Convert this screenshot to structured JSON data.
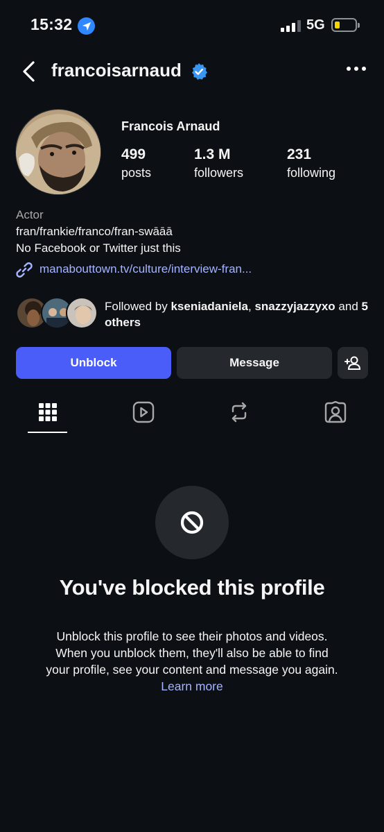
{
  "status_bar": {
    "time": "15:32",
    "network": "5G",
    "battery_level": 0.2,
    "icons": [
      "location-arrow-icon",
      "cellular-signal-icon",
      "battery-icon"
    ]
  },
  "header": {
    "username": "francoisarnaud",
    "verified": true,
    "icons": [
      "back-chevron-icon",
      "verified-badge-icon",
      "more-options-icon"
    ]
  },
  "profile": {
    "display_name": "Francois Arnaud",
    "stats": {
      "posts_value": "499",
      "posts_label": "posts",
      "followers_value": "1.3 M",
      "followers_label": "followers",
      "following_value": "231",
      "following_label": "following"
    },
    "category": "Actor",
    "bio_line1": "fran/frankie/franco/fran-swāāā",
    "bio_line2": "No Facebook or Twitter just this",
    "link": "manabouttown.tv/culture/interview-fran..."
  },
  "mutuals": {
    "prefix": "Followed by",
    "user1": "kseniadaniela",
    "separator": ",",
    "user2": "snazzyjazzyxo",
    "middle": "and",
    "others": "5 others"
  },
  "actions": {
    "unblock_label": "Unblock",
    "message_label": "Message"
  },
  "tabs": [
    "grid-icon",
    "reels-icon",
    "reposts-icon",
    "tagged-icon"
  ],
  "blocked": {
    "title": "You've blocked this profile",
    "message": "Unblock this profile to see their photos and videos. When you unblock them, they'll also be able to find your profile, see your content and message you again.",
    "learn_more": "Learn more"
  },
  "colors": {
    "background": "#0c1014",
    "accent_button": "#4a5df9",
    "link": "#a5b4ff",
    "secondary_button": "#25292e",
    "verified_badge": "#3897f0"
  }
}
